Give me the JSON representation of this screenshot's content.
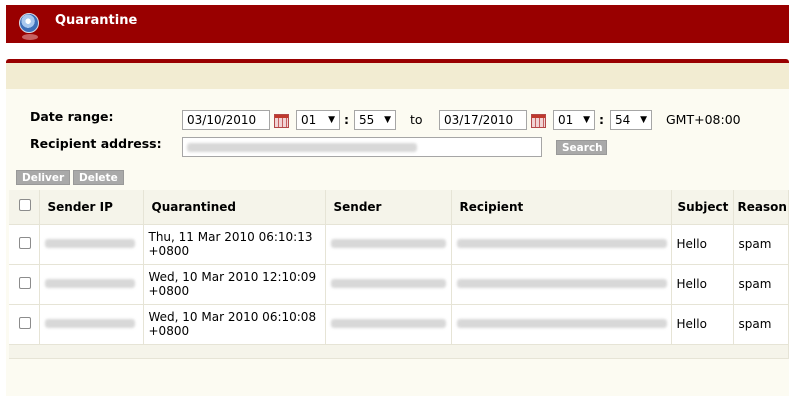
{
  "header": {
    "title": "Quarantine",
    "logo_icon": "globe-icon"
  },
  "filter": {
    "date_range_label": "Date range:",
    "from_date": "03/10/2010",
    "from_hour": "01",
    "from_minute": "55",
    "to_label": "to",
    "to_date": "03/17/2010",
    "to_hour": "01",
    "to_minute": "54",
    "timezone": "GMT+08:00",
    "colon": ":",
    "recipient_label": "Recipient address:",
    "search_label": "Search"
  },
  "actions": {
    "deliver_label": "Deliver",
    "delete_label": "Delete"
  },
  "table": {
    "headers": [
      "Sender IP",
      "Quarantined",
      "Sender",
      "Recipient",
      "Subject",
      "Reason"
    ],
    "rows": [
      {
        "quarantined_line1": "Thu, 11 Mar 2010 06:10:13",
        "quarantined_line2": "+0800",
        "subject": "Hello",
        "reason": "spam"
      },
      {
        "quarantined_line1": "Wed, 10 Mar 2010 12:10:09",
        "quarantined_line2": "+0800",
        "subject": "Hello",
        "reason": "spam"
      },
      {
        "quarantined_line1": "Wed, 10 Mar 2010 06:10:08",
        "quarantined_line2": "+0800",
        "subject": "Hello",
        "reason": "spam"
      }
    ]
  },
  "colors": {
    "brand": "#990000",
    "panel": "#fcfbf2",
    "button": "#a9a9a9"
  }
}
